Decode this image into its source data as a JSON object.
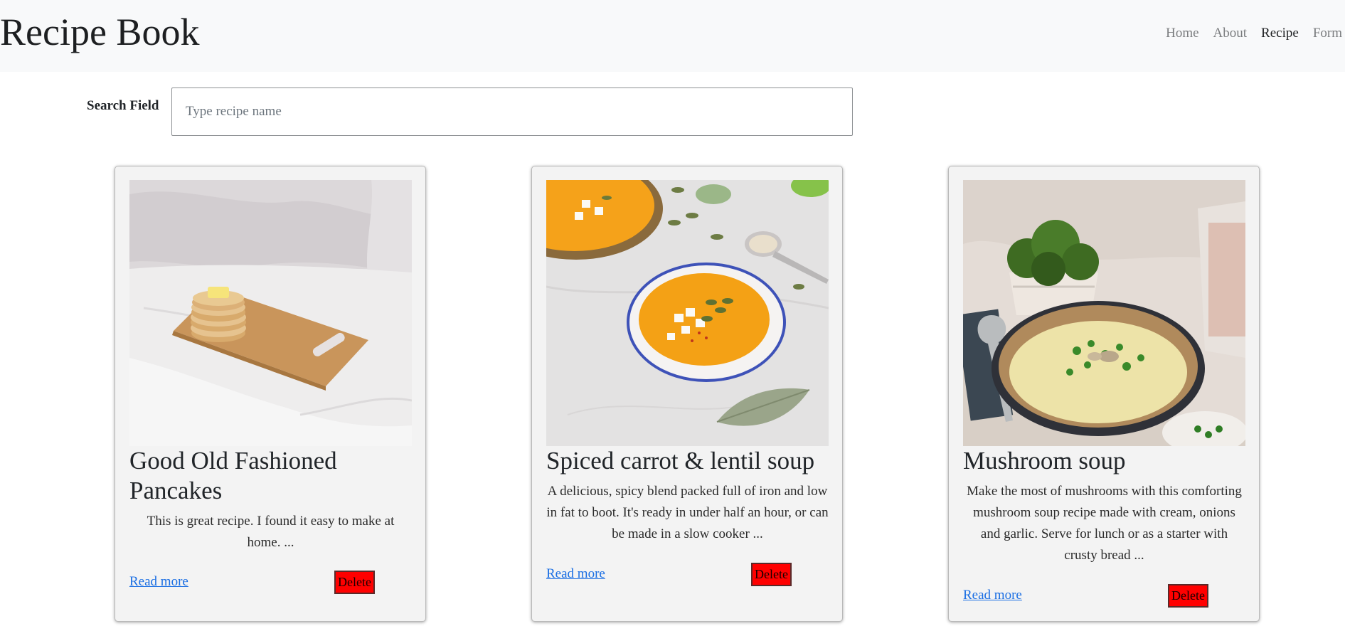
{
  "navbar": {
    "brand": "Recipe Book",
    "links": [
      {
        "label": "Home",
        "active": false
      },
      {
        "label": "About",
        "active": false
      },
      {
        "label": "Recipe",
        "active": true
      },
      {
        "label": "Form",
        "active": false
      }
    ]
  },
  "search": {
    "label": "Search Field",
    "placeholder": "Type recipe name",
    "value": ""
  },
  "recipes": [
    {
      "title": "Good Old Fashioned Pancakes",
      "description": "This is great recipe. I found it easy to make at home. ...",
      "read_more": "Read more",
      "delete": "Delete"
    },
    {
      "title": "Spiced carrot & lentil soup",
      "description": "A delicious, spicy blend packed full of iron and low in fat to boot. It's ready in under half an hour, or can be made in a slow cooker ...",
      "read_more": "Read more",
      "delete": "Delete"
    },
    {
      "title": "Mushroom soup",
      "description": "Make the most of mushrooms with this comforting mushroom soup recipe made with cream, onions and garlic. Serve for lunch or as a starter with crusty bread ...",
      "read_more": "Read more",
      "delete": "Delete"
    }
  ],
  "colors": {
    "navbar_bg": "#f8f9fa",
    "card_bg": "#f3f3f3",
    "link": "#1a6ee3",
    "delete_bg": "#ff0000"
  }
}
